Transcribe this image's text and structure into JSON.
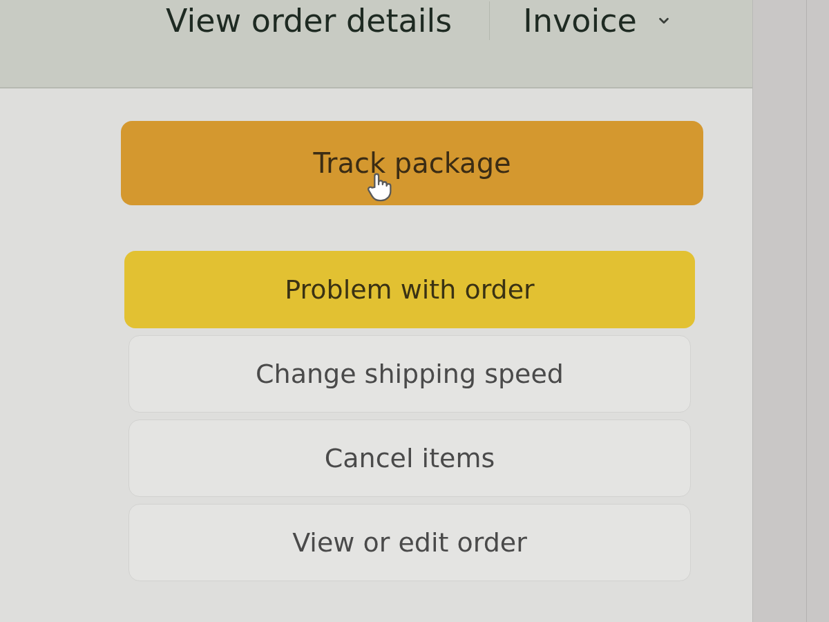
{
  "header": {
    "links": [
      {
        "label": "View order details",
        "kind": "link"
      },
      {
        "label": "Invoice",
        "kind": "dropdown"
      }
    ]
  },
  "actions": [
    {
      "label": "Track package",
      "kind": "primary",
      "hovered": true
    },
    {
      "label": "Problem with order",
      "kind": "secondary",
      "hovered": false
    },
    {
      "label": "Change shipping speed",
      "kind": "outline",
      "hovered": false
    },
    {
      "label": "Cancel items",
      "kind": "outline",
      "hovered": false
    },
    {
      "label": "View or edit order",
      "kind": "outline",
      "hovered": false
    }
  ]
}
